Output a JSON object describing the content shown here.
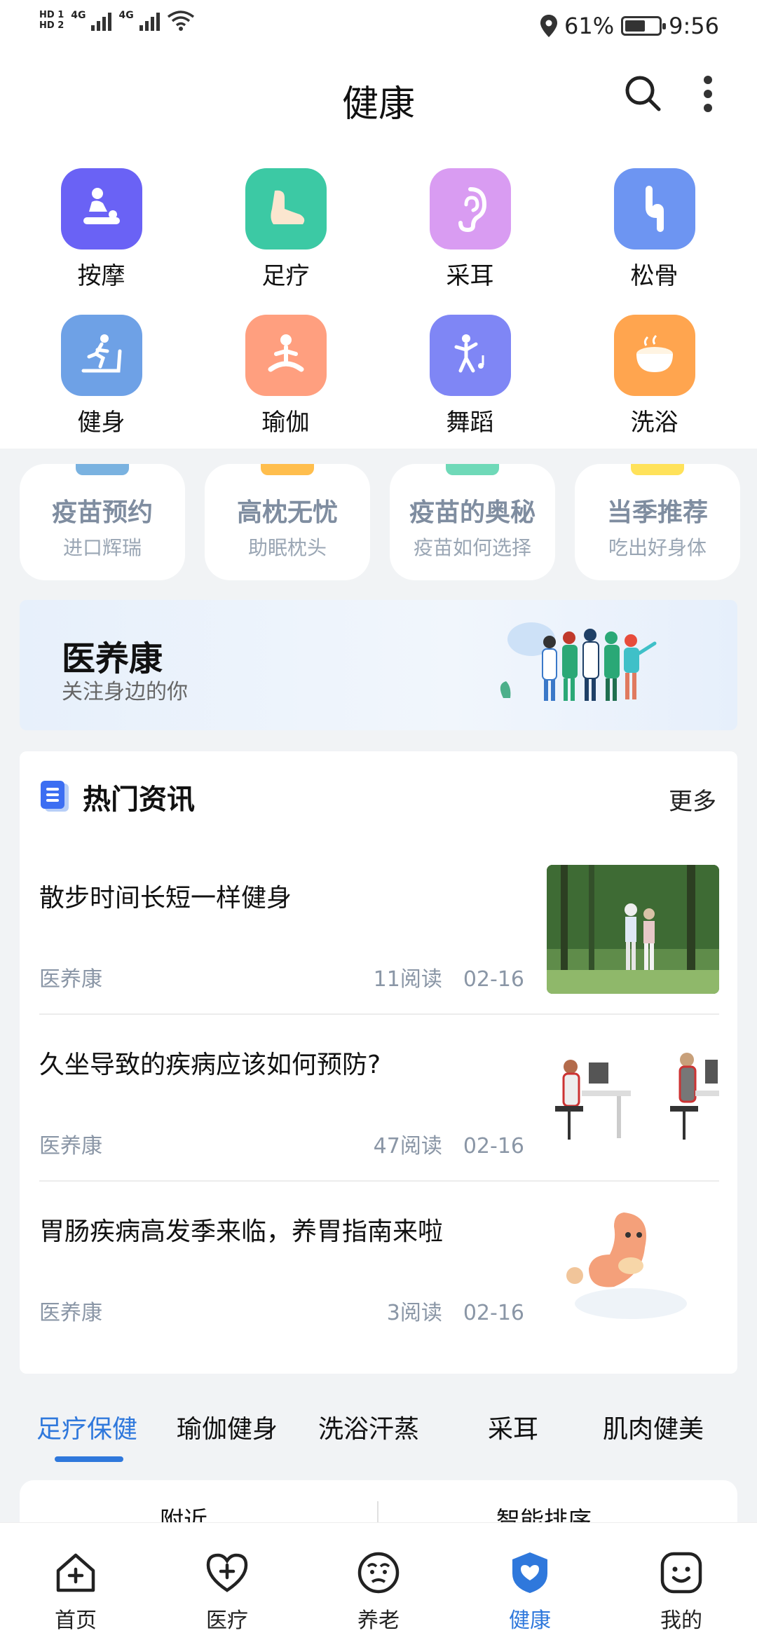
{
  "status_bar": {
    "hd1": "HD 1",
    "hd2": "HD 2",
    "net1": "4G",
    "net2": "4G",
    "battery": "61%",
    "battery_level": 0.61,
    "time": "9:56"
  },
  "header": {
    "title": "健康"
  },
  "categories": [
    {
      "label": "按摩",
      "icon": "massage-icon",
      "color": "#6a62f5"
    },
    {
      "label": "足疗",
      "icon": "foot-icon",
      "color": "#3cc9a4"
    },
    {
      "label": "采耳",
      "icon": "ear-icon",
      "color": "#d99cf2"
    },
    {
      "label": "松骨",
      "icon": "bone-icon",
      "color": "#6d95f2"
    },
    {
      "label": "健身",
      "icon": "treadmill-icon",
      "color": "#6ea1e6"
    },
    {
      "label": "瑜伽",
      "icon": "yoga-icon",
      "color": "#ff9f7f"
    },
    {
      "label": "舞蹈",
      "icon": "dance-icon",
      "color": "#7f86f5"
    },
    {
      "label": "洗浴",
      "icon": "bath-icon",
      "color": "#ffa54f"
    }
  ],
  "promo_cards": [
    {
      "title": "疫苗预约",
      "subtitle": "进口辉瑞",
      "accent": "#7ab2e0"
    },
    {
      "title": "高枕无忧",
      "subtitle": "助眠枕头",
      "accent": "#ffbe4d"
    },
    {
      "title": "疫苗的奥秘",
      "subtitle": "疫苗如何选择",
      "accent": "#6fd9b8"
    },
    {
      "title": "当季推荐",
      "subtitle": "吃出好身体",
      "accent": "#ffe25a"
    }
  ],
  "banner": {
    "title": "医养康",
    "subtitle": "关注身边的你"
  },
  "news": {
    "title": "热门资讯",
    "more": "更多",
    "items": [
      {
        "title": "散步时间长短一样健身",
        "source": "医养康",
        "meta": "11阅读　02-16"
      },
      {
        "title": "久坐导致的疾病应该如何预防?",
        "source": "医养康",
        "meta": "47阅读　02-16"
      },
      {
        "title": "胃肠疾病高发季来临，养胃指南来啦",
        "source": "医养康",
        "meta": "3阅读　02-16"
      }
    ]
  },
  "tabs": [
    "足疗保健",
    "瑜伽健身",
    "洗浴汗蒸",
    "采耳",
    "肌肉健美"
  ],
  "filter": {
    "nearby": "附近",
    "sort": "智能排序"
  },
  "bottom_nav": [
    {
      "label": "首页",
      "icon": "home-icon"
    },
    {
      "label": "医疗",
      "icon": "medical-heart-icon"
    },
    {
      "label": "养老",
      "icon": "elderly-face-icon"
    },
    {
      "label": "健康",
      "icon": "health-shield-icon"
    },
    {
      "label": "我的",
      "icon": "profile-face-icon"
    }
  ],
  "colors": {
    "accent": "#2f78dc"
  }
}
